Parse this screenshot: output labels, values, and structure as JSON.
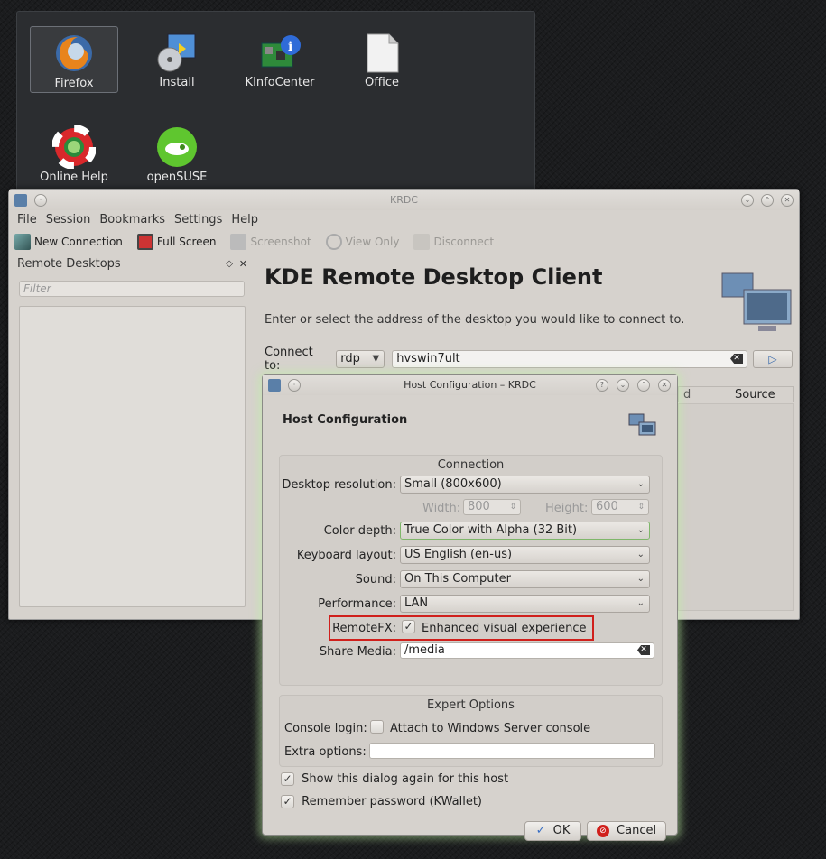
{
  "desktop": {
    "icons": [
      {
        "label": "Firefox",
        "icon": "firefox-icon"
      },
      {
        "label": "Install",
        "icon": "install-disc-icon"
      },
      {
        "label": "KInfoCenter",
        "icon": "kinfocenter-icon"
      },
      {
        "label": "Office",
        "icon": "office-document-icon"
      },
      {
        "label": "Online Help",
        "icon": "help-lifebuoy-icon"
      },
      {
        "label": "openSUSE",
        "icon": "opensuse-icon"
      }
    ]
  },
  "krdc": {
    "title": "KRDC",
    "menu": [
      "File",
      "Session",
      "Bookmarks",
      "Settings",
      "Help"
    ],
    "toolbar": {
      "new_connection": "New Connection",
      "full_screen": "Full Screen",
      "screenshot": "Screenshot",
      "view_only": "View Only",
      "disconnect": "Disconnect"
    },
    "sidebar": {
      "title": "Remote Desktops",
      "filter_placeholder": "Filter"
    },
    "main": {
      "title": "KDE Remote Desktop Client",
      "subtitle": "Enter or select the address of the desktop you would like to connect to.",
      "connect_label": "Connect to:",
      "protocol": "rdp",
      "address": "hvswin7ult",
      "list_header_partial": "d",
      "list_header_source": "Source"
    }
  },
  "dialog": {
    "title": "Host Configuration – KRDC",
    "heading": "Host Configuration",
    "connection": {
      "title": "Connection",
      "desktop_resolution_label": "Desktop resolution:",
      "desktop_resolution": "Small (800x600)",
      "width_label": "Width:",
      "width": "800",
      "height_label": "Height:",
      "height": "600",
      "color_depth_label": "Color depth:",
      "color_depth": "True Color with Alpha (32 Bit)",
      "keyboard_label": "Keyboard layout:",
      "keyboard": "US English (en-us)",
      "sound_label": "Sound:",
      "sound": "On This Computer",
      "performance_label": "Performance:",
      "performance": "LAN",
      "remotefx_label": "RemoteFX:",
      "remotefx_text": "Enhanced visual experience",
      "remotefx_checked": true,
      "share_media_label": "Share Media:",
      "share_media": "/media"
    },
    "expert": {
      "title": "Expert Options",
      "console_label": "Console login:",
      "console_text": "Attach to Windows Server console",
      "extra_label": "Extra options:",
      "extra_value": ""
    },
    "show_again": "Show this dialog again for this host",
    "remember_password": "Remember password (KWallet)",
    "ok": "OK",
    "cancel": "Cancel",
    "highlight_color": "#d0201c"
  }
}
